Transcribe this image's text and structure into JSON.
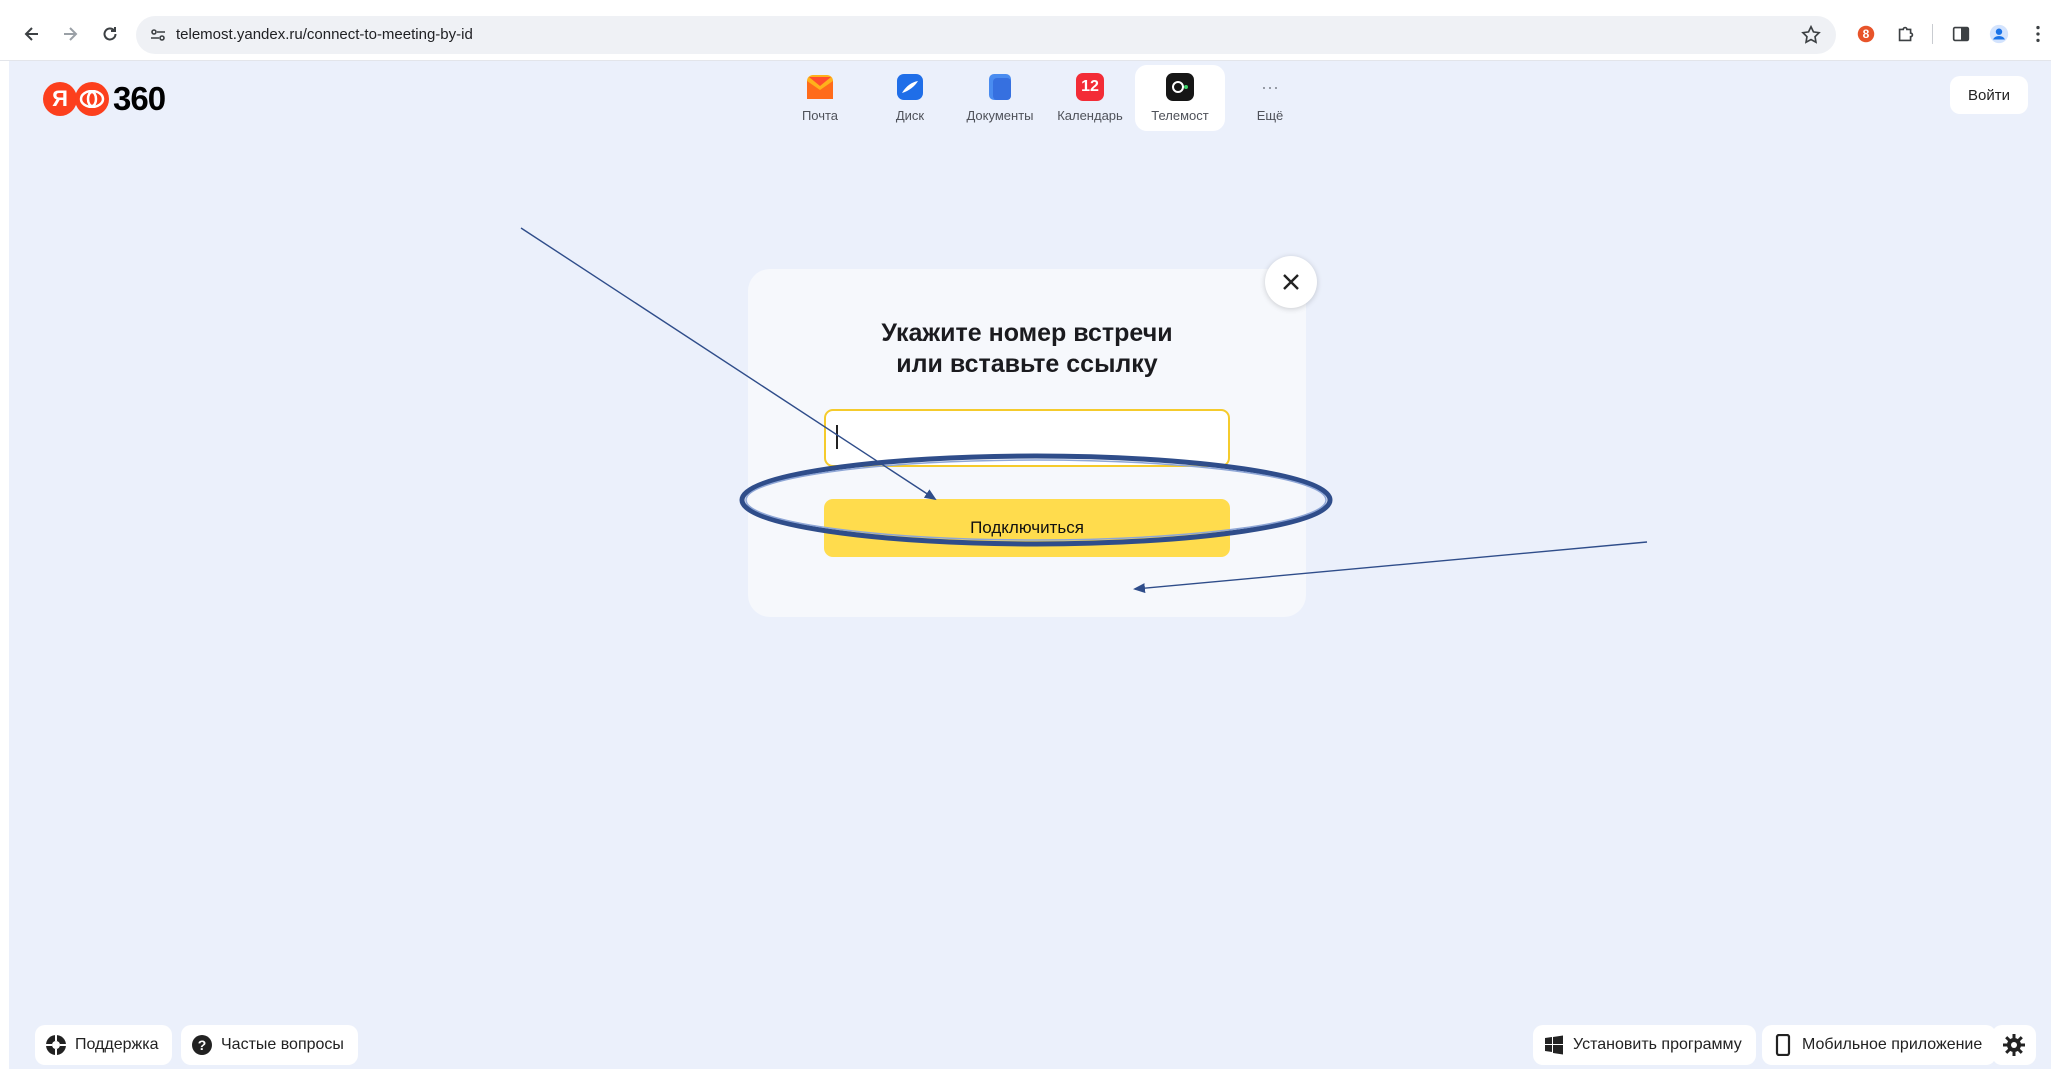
{
  "browser": {
    "url": "telemost.yandex.ru/connect-to-meeting-by-id",
    "extension_badge": "8"
  },
  "header": {
    "logo": {
      "ya": "Я",
      "number": "360"
    },
    "services": [
      {
        "label": "Почта",
        "icon": "mail-icon"
      },
      {
        "label": "Диск",
        "icon": "disk-icon"
      },
      {
        "label": "Документы",
        "icon": "documents-icon"
      },
      {
        "label": "Календарь",
        "icon": "calendar-icon",
        "badge": "12"
      },
      {
        "label": "Телемост",
        "icon": "telemost-icon",
        "active": true
      },
      {
        "label": "Ещё",
        "icon": "more-icon",
        "glyph": "···"
      }
    ],
    "login_label": "Войти"
  },
  "dialog": {
    "title_line1": "Укажите номер встречи",
    "title_line2": "или вставьте ссылку",
    "input_value": "",
    "button_label": "Подключиться"
  },
  "footer": {
    "support_label": "Поддержка",
    "faq_label": "Частые вопросы",
    "install_label": "Установить программу",
    "mobile_label": "Мобильное приложение"
  },
  "colors": {
    "page_bg": "#ebf0fb",
    "accent_yellow": "#ffdc4d",
    "annotation_blue": "#2f4d8a"
  }
}
